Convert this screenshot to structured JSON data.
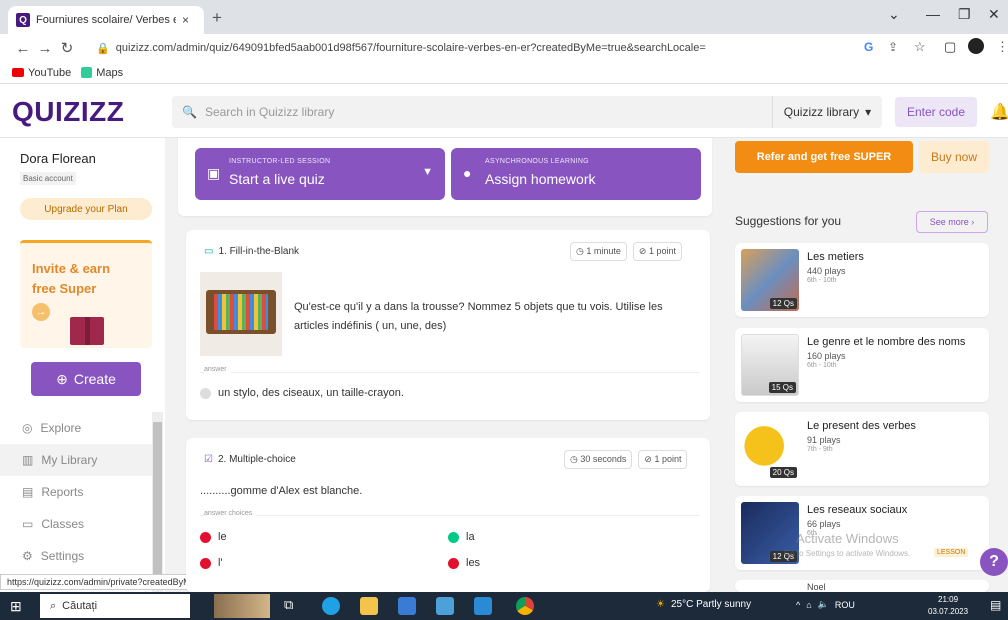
{
  "browser": {
    "tab_title": "Fourniures scolaire/ Verbes en",
    "tab_close": "×",
    "new_tab": "+",
    "url": "quizizz.com/admin/quiz/649091bfed5aab001d98f567/fourniture-scolaire-verbes-en-er?createdByMe=true&searchLocale=",
    "bookmarks": [
      {
        "label": "YouTube",
        "icon": "youtube-icon"
      },
      {
        "label": "Maps",
        "icon": "maps-icon"
      }
    ],
    "status_url": "https://quizizz.com/admin/private?createdByMe=true"
  },
  "header": {
    "logo": "QUIZIZZ",
    "search_placeholder": "Search in Quizizz library",
    "library_select": "Quizizz library",
    "enter_code": "Enter code"
  },
  "sidebar": {
    "user_name": "Dora Florean",
    "account_type": "Basic account",
    "upgrade": "Upgrade your Plan",
    "invite_line1": "Invite & earn",
    "invite_line2": "free Super",
    "create": "Create",
    "nav": [
      {
        "label": "Explore",
        "icon": "compass-icon"
      },
      {
        "label": "My Library",
        "icon": "library-icon"
      },
      {
        "label": "Reports",
        "icon": "reports-icon"
      },
      {
        "label": "Classes",
        "icon": "classes-icon"
      },
      {
        "label": "Settings",
        "icon": "gear-icon"
      }
    ]
  },
  "actions": {
    "live_small": "INSTRUCTOR-LED SESSION",
    "live_big": "Start a live quiz",
    "hw_small": "ASYNCHRONOUS LEARNING",
    "hw_big": "Assign homework"
  },
  "questions": [
    {
      "title": "1. Fill-in-the-Blank",
      "time": "1 minute",
      "points": "1 point",
      "text": "Qu'est-ce qu'il y a dans la trousse? Nommez 5 objets que tu vois. Utilise les articles indéfinis ( un, une, des)",
      "answer_label": "answer",
      "answer": "un stylo, des ciseaux, un taille-crayon."
    },
    {
      "title": "2. Multiple-choice",
      "time": "30 seconds",
      "points": "1 point",
      "text": "..........gomme d'Alex est blanche.",
      "choices_label": "answer choices",
      "choices": [
        {
          "text": "le",
          "correct": false
        },
        {
          "text": "la",
          "correct": true
        },
        {
          "text": "l'",
          "correct": false
        },
        {
          "text": "les",
          "correct": false
        }
      ]
    }
  ],
  "right": {
    "refer": "Refer and get free SUPER",
    "buy_now": "Buy now",
    "suggestions_title": "Suggestions for you",
    "see_more": "See more",
    "suggestions": [
      {
        "name": "Les metiers",
        "plays": "440 plays",
        "grade": "6th - 10th",
        "qs": "12 Qs"
      },
      {
        "name": "Le genre et le nombre des noms",
        "plays": "160 plays",
        "grade": "6th - 10th",
        "qs": "15 Qs"
      },
      {
        "name": "Le present des verbes",
        "plays": "91 plays",
        "grade": "7th - 9th",
        "qs": "20 Qs"
      },
      {
        "name": "Les reseaux sociaux",
        "plays": "66 plays",
        "grade": "6th",
        "qs": "12 Qs"
      }
    ],
    "partial_next": "Noel",
    "watermark_line1": "Activate Windows",
    "watermark_line2": "Go to Settings to activate Windows.",
    "lesson_badge": "LESSON"
  },
  "taskbar": {
    "search": "Căutați",
    "weather": "25°C  Partly sunny",
    "lang": "ROU",
    "time": "21:09",
    "date": "03.07.2023"
  },
  "colors": {
    "brand": "#8854c0",
    "logo": "#461a7e",
    "orange": "#f28c13",
    "correct": "#00c985",
    "incorrect": "#e2102e"
  }
}
